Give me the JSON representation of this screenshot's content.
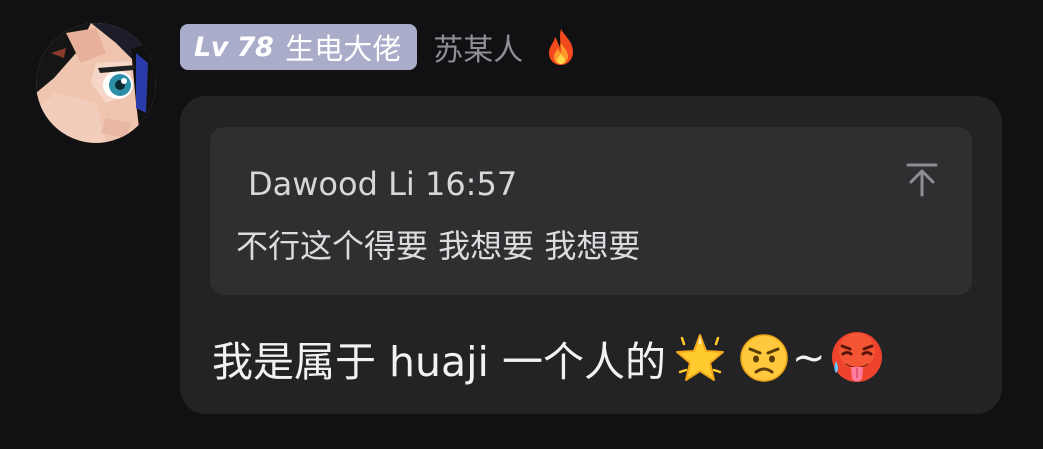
{
  "header": {
    "level_label": "Lv 78",
    "title_label": "生电大佬",
    "username": "苏某人",
    "badge_icon": "fire-icon",
    "badge_color": "#a9adc9"
  },
  "reply": {
    "author_time": "Dawood Li 16:57",
    "quoted_text": "不行这个得要 我想要 我想要",
    "jump_icon": "jump-to-top-icon"
  },
  "message": {
    "text": "我是属于 huaji 一个人的",
    "emojis": [
      "star-icon",
      "angry-face-icon",
      "hot-face-icon"
    ],
    "tilde": "~"
  },
  "colors": {
    "background": "#111113",
    "bubble": "#232325",
    "quote": "#2f2f32"
  }
}
